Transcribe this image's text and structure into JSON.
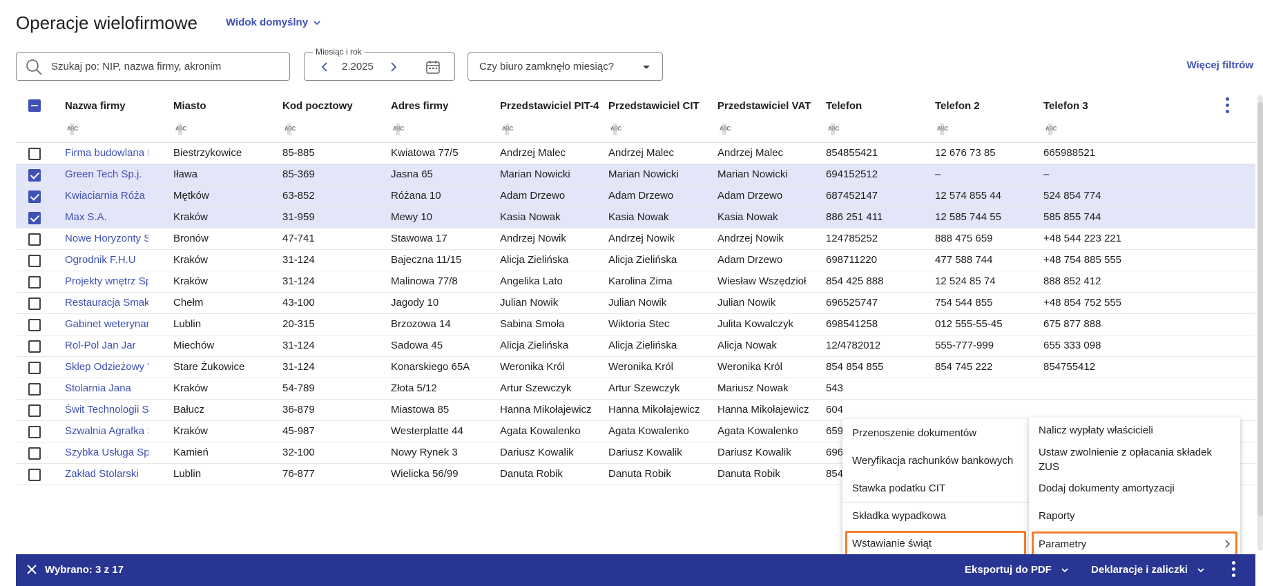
{
  "page": {
    "title": "Operacje wielofirmowe",
    "view_label": "Widok domyślny"
  },
  "filters": {
    "search_placeholder": "Szukaj po: NIP, nazwa firmy, akronim",
    "month_label": "Miesiąc i rok",
    "month_value": "2.2025",
    "closed_month_label": "Czy biuro zamknęło miesiąc?",
    "more_filters": "Więcej filtrów"
  },
  "table": {
    "columns": [
      "Nazwa firmy",
      "Miasto",
      "Kod pocztowy",
      "Adres firmy",
      "Przedstawiciel PIT-4",
      "Przedstawiciel CIT",
      "Przedstawiciel VAT",
      "Telefon",
      "Telefon 2",
      "Telefon 3"
    ],
    "filter_icon_text": "ABC",
    "rows": [
      {
        "checked": false,
        "cells": [
          "Firma budowlana BC",
          "Biestrzykowice",
          "85-885",
          "Kwiatowa 77/5",
          "Andrzej Malec",
          "Andrzej Malec",
          "Andrzej Malec",
          "854855421",
          "12 676 73 85",
          "665988521"
        ]
      },
      {
        "checked": true,
        "cells": [
          "Green Tech Sp.j.",
          "Iława",
          "85-369",
          "Jasna 65",
          "Marian Nowicki",
          "Marian Nowicki",
          "Marian Nowicki",
          "694152512",
          "–",
          "–"
        ]
      },
      {
        "checked": true,
        "cells": [
          "Kwiaciarnia Róża Sp",
          "Mętków",
          "63-852",
          "Różana 10",
          "Adam Drzewo",
          "Adam Drzewo",
          "Adam Drzewo",
          "687452147",
          "12 574 855 44",
          "524 854 774"
        ]
      },
      {
        "checked": true,
        "cells": [
          "Max S.A.",
          "Kraków",
          "31-959",
          "Mewy 10",
          "Kasia Nowak",
          "Kasia Nowak",
          "Kasia Nowak",
          "886 251 411",
          "12 585 744 55",
          "585 855 744"
        ]
      },
      {
        "checked": false,
        "cells": [
          "Nowe Horyzonty Sp.",
          "Bronów",
          "47-741",
          "Stawowa 17",
          "Andrzej Nowik",
          "Andrzej Nowik",
          "Andrzej Nowik",
          "124785252",
          "888 475 659",
          "+48 544 223 221"
        ]
      },
      {
        "checked": false,
        "cells": [
          "Ogrodnik F.H.U",
          "Kraków",
          "31-124",
          "Bajeczna 11/15",
          "Alicja Zielińska",
          "Alicja Zielińska",
          "Adam Drzewo",
          "698711220",
          "477 588 744",
          "+48 754 885 555"
        ]
      },
      {
        "checked": false,
        "cells": [
          "Projekty wnętrz Spół",
          "Kraków",
          "31-124",
          "Malinowa 77/8",
          "Angelika Lato",
          "Karolina Zima",
          "Wiesław Wszędzioł",
          "854 425 888",
          "12 524 85 74",
          "888 852 412"
        ]
      },
      {
        "checked": false,
        "cells": [
          "Restauracja Smakos",
          "Chełm",
          "43-100",
          "Jagody 10",
          "Julian Nowik",
          "Julian Nowik",
          "Julian Nowik",
          "696525747",
          "754 544 855",
          "+48 854 752 555"
        ]
      },
      {
        "checked": false,
        "cells": [
          "Gabinet weterynaryj",
          "Lublin",
          "20-315",
          "Brzozowa 14",
          "Sabina Smoła",
          "Wiktoria Stec",
          "Julita Kowalczyk",
          "698541258",
          "012 555-55-45",
          "675 877 888"
        ]
      },
      {
        "checked": false,
        "cells": [
          "Rol-Pol Jan Jar",
          "Miechów",
          "31-124",
          "Sadowa 45",
          "Alicja Zielińska",
          "Alicja Zielińska",
          "Alicja Nowak",
          "12/4782012",
          "555-777-999",
          "655 333 098"
        ]
      },
      {
        "checked": false,
        "cells": [
          "Sklep Odzieżowy \"SZ",
          "Stare Żukowice",
          "31-124",
          "Konarskiego 65A",
          "Weronika Król",
          "Weronika Król",
          "Weronika Król",
          "854 854 855",
          "854 745 222",
          "854755412"
        ]
      },
      {
        "checked": false,
        "cells": [
          "Stolarnia Jana",
          "Kraków",
          "54-789",
          "Złota 5/12",
          "Artur Szewczyk",
          "Artur Szewczyk",
          "Mariusz Nowak",
          "543",
          "",
          ""
        ]
      },
      {
        "checked": false,
        "cells": [
          "Świt Technologii Sp.",
          "Bałucz",
          "36-879",
          "Miastowa 85",
          "Hanna Mikołajewicz",
          "Hanna Mikołajewicz",
          "Hanna Mikołajewicz",
          "604",
          "",
          ""
        ]
      },
      {
        "checked": false,
        "cells": [
          "Szwalnia Agrafka Sp",
          "Kraków",
          "45-987",
          "Westerplatte 44",
          "Agata Kowalenko",
          "Agata Kowalenko",
          "Agata Kowalenko",
          "659",
          "",
          ""
        ]
      },
      {
        "checked": false,
        "cells": [
          "Szybka Usługa Sp. z",
          "Kamień",
          "32-100",
          "Nowy Rynek 3",
          "Dariusz Kowalik",
          "Dariusz Kowalik",
          "Dariusz Kowalik",
          "696",
          "",
          ""
        ]
      },
      {
        "checked": false,
        "cells": [
          "Zakład Stolarski",
          "Lublin",
          "76-877",
          "Wielicka 56/99",
          "Danuta Robik",
          "Danuta Robik",
          "Danuta Robik",
          "854",
          "",
          ""
        ]
      }
    ]
  },
  "bottom_bar": {
    "selected_text": "Wybrano: 3 z 17",
    "export_pdf": "Eksportuj do PDF",
    "declarations": "Deklaracje i zaliczki",
    "bg_color": "#283593"
  },
  "menu_left": {
    "items": [
      "Przenoszenie dokumentów",
      "Weryfikacja rachunków bankowych",
      "Stawka podatku CIT",
      "Składka wypadkowa",
      "Wstawianie świąt"
    ]
  },
  "menu_right": {
    "items": [
      "Nalicz wypłaty właścicieli",
      "Ustaw zwolnienie z opłacania składek ZUS",
      "Dodaj dokumenty amortyzacji",
      "Raporty",
      "Parametry"
    ]
  },
  "colors": {
    "accent": "#3f51b5",
    "selected_row": "#e3e5f8",
    "highlight": "#f57c2b"
  }
}
